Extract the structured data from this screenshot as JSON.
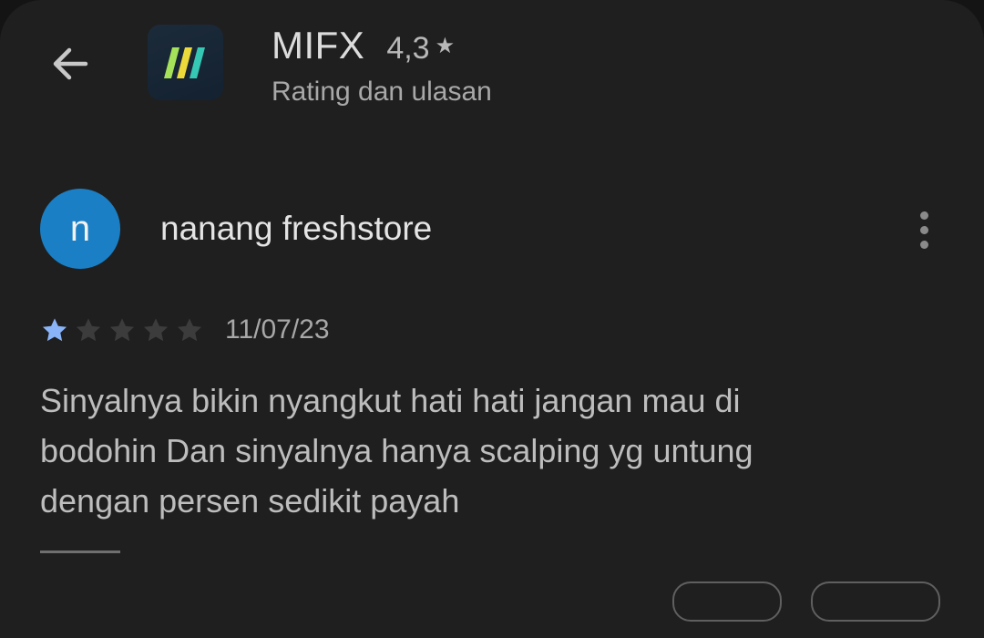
{
  "header": {
    "back_icon": "arrow-back-icon",
    "app_icon": "mifx-logo-icon",
    "app_name": "MIFX",
    "rating": "4,3",
    "rating_star": "★",
    "subtitle": "Rating dan ulasan"
  },
  "review": {
    "avatar_letter": "n",
    "avatar_color": "#1a7fc4",
    "author": "nanang freshstore",
    "more_icon": "more-vert-icon",
    "stars_filled": 1,
    "stars_total": 5,
    "star_filled_color": "#8ab4f8",
    "star_empty_color": "#3c3c3c",
    "date": "11/07/23",
    "text": "Sinyalnya bikin nyangkut hati hati jangan mau di bodohin Dan sinyalnya hanya scalping yg untung dengan persen sedikit payah"
  }
}
